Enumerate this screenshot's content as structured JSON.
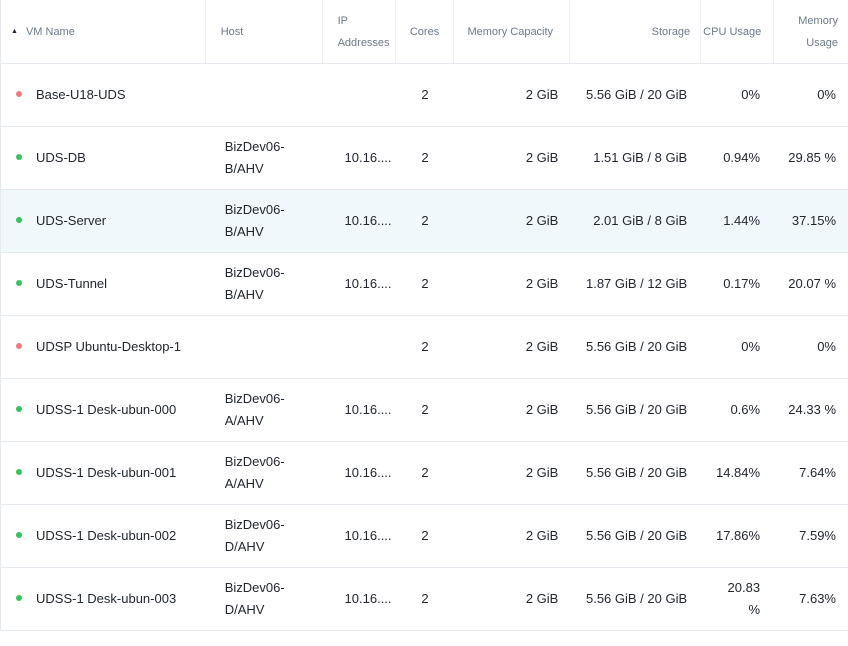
{
  "columns": {
    "vm_name": "VM Name",
    "host": "Host",
    "ip": "IP Addresses",
    "cores": "Cores",
    "memory_capacity": "Memory Capacity",
    "storage": "Storage",
    "cpu_usage": "CPU Usage",
    "memory_usage": "Memory Usage"
  },
  "sort_icon": "caret-up-icon",
  "colors": {
    "status_on": "#36c35e",
    "status_off": "#ef7b7b",
    "selected_row": "#f1f8fc"
  },
  "rows": [
    {
      "status": "off",
      "name": "Base-U18-UDS",
      "host": "",
      "ip": "",
      "cores": "2",
      "memory": "2 GiB",
      "storage": "5.56 GiB / 20 GiB",
      "cpu": "0%",
      "mem_usage": "0%"
    },
    {
      "status": "on",
      "name": "UDS-DB",
      "host": "BizDev06-B/AHV",
      "ip": "10.16....",
      "cores": "2",
      "memory": "2 GiB",
      "storage": "1.51 GiB / 8 GiB",
      "cpu": "0.94%",
      "mem_usage": "29.85 %"
    },
    {
      "status": "on",
      "name": "UDS-Server",
      "host": "BizDev06-B/AHV",
      "ip": "10.16....",
      "cores": "2",
      "memory": "2 GiB",
      "storage": "2.01 GiB / 8 GiB",
      "cpu": "1.44%",
      "mem_usage": "37.15%",
      "selected": true
    },
    {
      "status": "on",
      "name": "UDS-Tunnel",
      "host": "BizDev06-B/AHV",
      "ip": "10.16....",
      "cores": "2",
      "memory": "2 GiB",
      "storage": "1.87 GiB / 12 GiB",
      "cpu": "0.17%",
      "mem_usage": "20.07 %"
    },
    {
      "status": "off",
      "name": "UDSP Ubuntu-Desktop-1",
      "host": "",
      "ip": "",
      "cores": "2",
      "memory": "2 GiB",
      "storage": "5.56 GiB / 20 GiB",
      "cpu": "0%",
      "mem_usage": "0%"
    },
    {
      "status": "on",
      "name": "UDSS-1 Desk-ubun-000",
      "host": "BizDev06-A/AHV",
      "ip": "10.16....",
      "cores": "2",
      "memory": "2 GiB",
      "storage": "5.56 GiB / 20 GiB",
      "cpu": "0.6%",
      "mem_usage": "24.33 %"
    },
    {
      "status": "on",
      "name": "UDSS-1 Desk-ubun-001",
      "host": "BizDev06-A/AHV",
      "ip": "10.16....",
      "cores": "2",
      "memory": "2 GiB",
      "storage": "5.56 GiB / 20 GiB",
      "cpu": "14.84%",
      "mem_usage": "7.64%"
    },
    {
      "status": "on",
      "name": "UDSS-1 Desk-ubun-002",
      "host": "BizDev06-D/AHV",
      "ip": "10.16....",
      "cores": "2",
      "memory": "2 GiB",
      "storage": "5.56 GiB / 20 GiB",
      "cpu": "17.86%",
      "mem_usage": "7.59%"
    },
    {
      "status": "on",
      "name": "UDSS-1 Desk-ubun-003",
      "host": "BizDev06-D/AHV",
      "ip": "10.16....",
      "cores": "2",
      "memory": "2 GiB",
      "storage": "5.56 GiB / 20 GiB",
      "cpu": "20.83 %",
      "mem_usage": "7.63%"
    }
  ]
}
